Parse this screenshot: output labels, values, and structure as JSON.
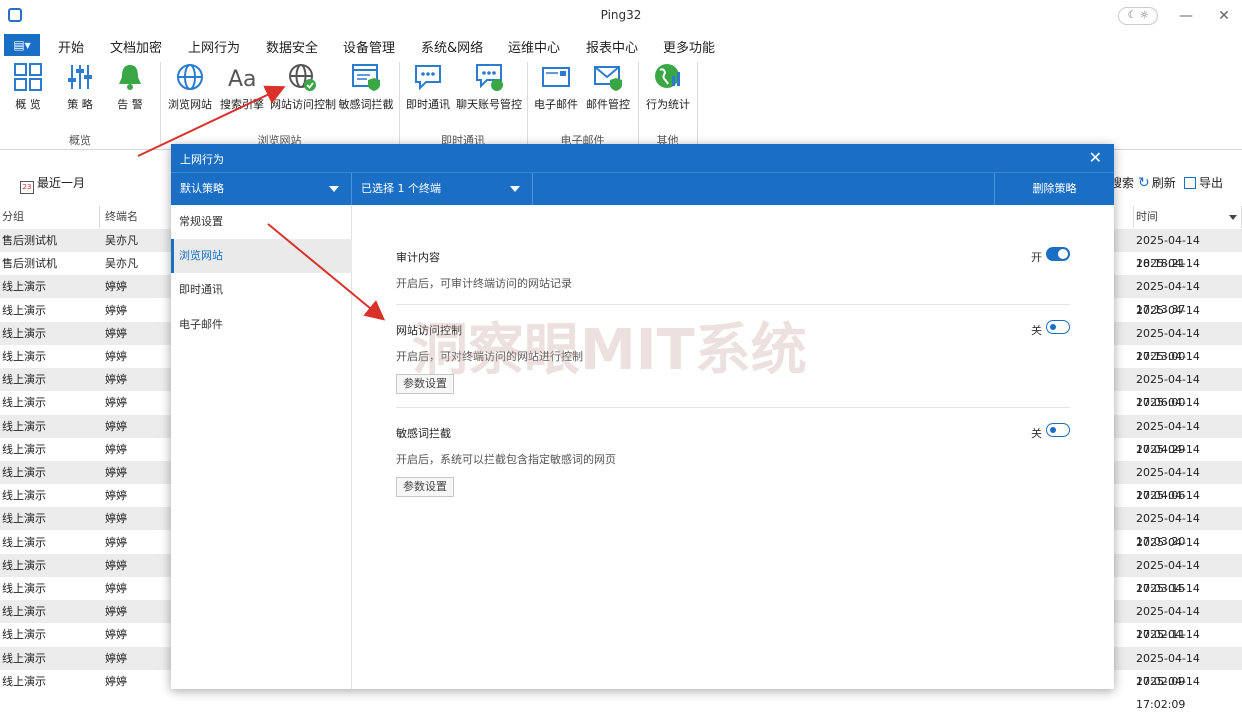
{
  "window": {
    "title": "Ping32",
    "theme_toggle": "☾ ☼",
    "minimize": "—",
    "close": "✕"
  },
  "menu": {
    "icon_btn": "▤▾",
    "items": [
      "开始",
      "文档加密",
      "上网行为",
      "数据安全",
      "设备管理",
      "系统&网络",
      "运维中心",
      "报表中心",
      "更多功能"
    ],
    "active_index": 2
  },
  "ribbon": {
    "buttons": [
      {
        "label": "概 览",
        "icon": "grid-icon"
      },
      {
        "label": "策 略",
        "icon": "sliders-icon"
      },
      {
        "label": "告 警",
        "icon": "bell-icon"
      },
      {
        "label": "浏览网站",
        "icon": "globe-icon"
      },
      {
        "label": "搜索引擎",
        "icon": "font-icon"
      },
      {
        "label": "网站访问控制",
        "icon": "globe-check-icon"
      },
      {
        "label": "敏感词拦截",
        "icon": "browser-shield-icon"
      },
      {
        "label": "即时通讯",
        "icon": "chat-icon"
      },
      {
        "label": "聊天账号管控",
        "icon": "chat-user-icon"
      },
      {
        "label": "电子邮件",
        "icon": "mail-icon"
      },
      {
        "label": "邮件管控",
        "icon": "mail-shield-icon"
      },
      {
        "label": "行为统计",
        "icon": "globe-chart-icon"
      }
    ],
    "groups": [
      "概览",
      "浏览网站",
      "即时通讯",
      "电子邮件",
      "其他"
    ]
  },
  "toolbar": {
    "date_filter": "最近一月",
    "search": "搜索",
    "refresh": "刷新",
    "export": "导出"
  },
  "table": {
    "headers": [
      "分组",
      "终端名",
      "时间"
    ],
    "rows": [
      {
        "group": "售后测试机",
        "terminal": "吴亦凡",
        "time": "2025-04-14 18:18:21"
      },
      {
        "group": "售后测试机",
        "terminal": "吴亦凡",
        "time": "2025-04-14 18:17:02"
      },
      {
        "group": "线上演示",
        "terminal": "婷婷",
        "time": "2025-04-14 17:13:37"
      },
      {
        "group": "线上演示",
        "terminal": "婷婷",
        "time": "2025-04-14 17:13:37"
      },
      {
        "group": "线上演示",
        "terminal": "婷婷",
        "time": "2025-04-14 17:13:00"
      },
      {
        "group": "线上演示",
        "terminal": "婷婷",
        "time": "2025-04-14 17:13:00"
      },
      {
        "group": "线上演示",
        "terminal": "婷婷",
        "time": "2025-04-14 17:06:00"
      },
      {
        "group": "线上演示",
        "terminal": "婷婷",
        "time": "2025-04-14 17:06:00"
      },
      {
        "group": "线上演示",
        "terminal": "婷婷",
        "time": "2025-04-14 17:04:29"
      },
      {
        "group": "线上演示",
        "terminal": "婷婷",
        "time": "2025-04-14 17:04:29"
      },
      {
        "group": "线上演示",
        "terminal": "婷婷",
        "time": "2025-04-14 17:04:06"
      },
      {
        "group": "线上演示",
        "terminal": "婷婷",
        "time": "2025-04-14 17:04:06"
      },
      {
        "group": "线上演示",
        "terminal": "婷婷",
        "time": "2025-04-14 17:03:20"
      },
      {
        "group": "线上演示",
        "terminal": "婷婷",
        "time": "2025-04-14 17:03:20"
      },
      {
        "group": "线上演示",
        "terminal": "婷婷",
        "time": "2025-04-14 17:03:15"
      },
      {
        "group": "线上演示",
        "terminal": "婷婷",
        "time": "2025-04-14 17:03:15"
      },
      {
        "group": "线上演示",
        "terminal": "婷婷",
        "time": "2025-04-14 17:02:11"
      },
      {
        "group": "线上演示",
        "terminal": "婷婷",
        "time": "2025-04-14 17:02:11"
      },
      {
        "group": "线上演示",
        "terminal": "婷婷",
        "time": "2025-04-14 17:02:09"
      },
      {
        "group": "线上演示",
        "terminal": "婷婷",
        "time": "2025-04-14 17:02:09"
      }
    ]
  },
  "modal": {
    "title": "上网行为",
    "close": "✕",
    "policy_select": "默认策略",
    "terminal_select": "已选择 1 个终端",
    "delete_policy": "删除策略",
    "nav": [
      "常规设置",
      "浏览网站",
      "即时通讯",
      "电子邮件"
    ],
    "active_nav": 1,
    "settings": [
      {
        "title": "审计内容",
        "desc": "开启后，可审计终端访问的网站记录",
        "state": "开",
        "on": true
      },
      {
        "title": "网站访问控制",
        "desc": "开启后，可对终端访问的网站进行控制",
        "state": "关",
        "on": false,
        "button": "参数设置"
      },
      {
        "title": "敏感词拦截",
        "desc": "开启后，系统可以拦截包含指定敏感词的网页",
        "state": "关",
        "on": false,
        "button": "参数设置"
      }
    ]
  },
  "watermark": "洞察眼MIT系统",
  "colors": {
    "accent": "#1a6fc4",
    "annotation": "#d9322b"
  }
}
